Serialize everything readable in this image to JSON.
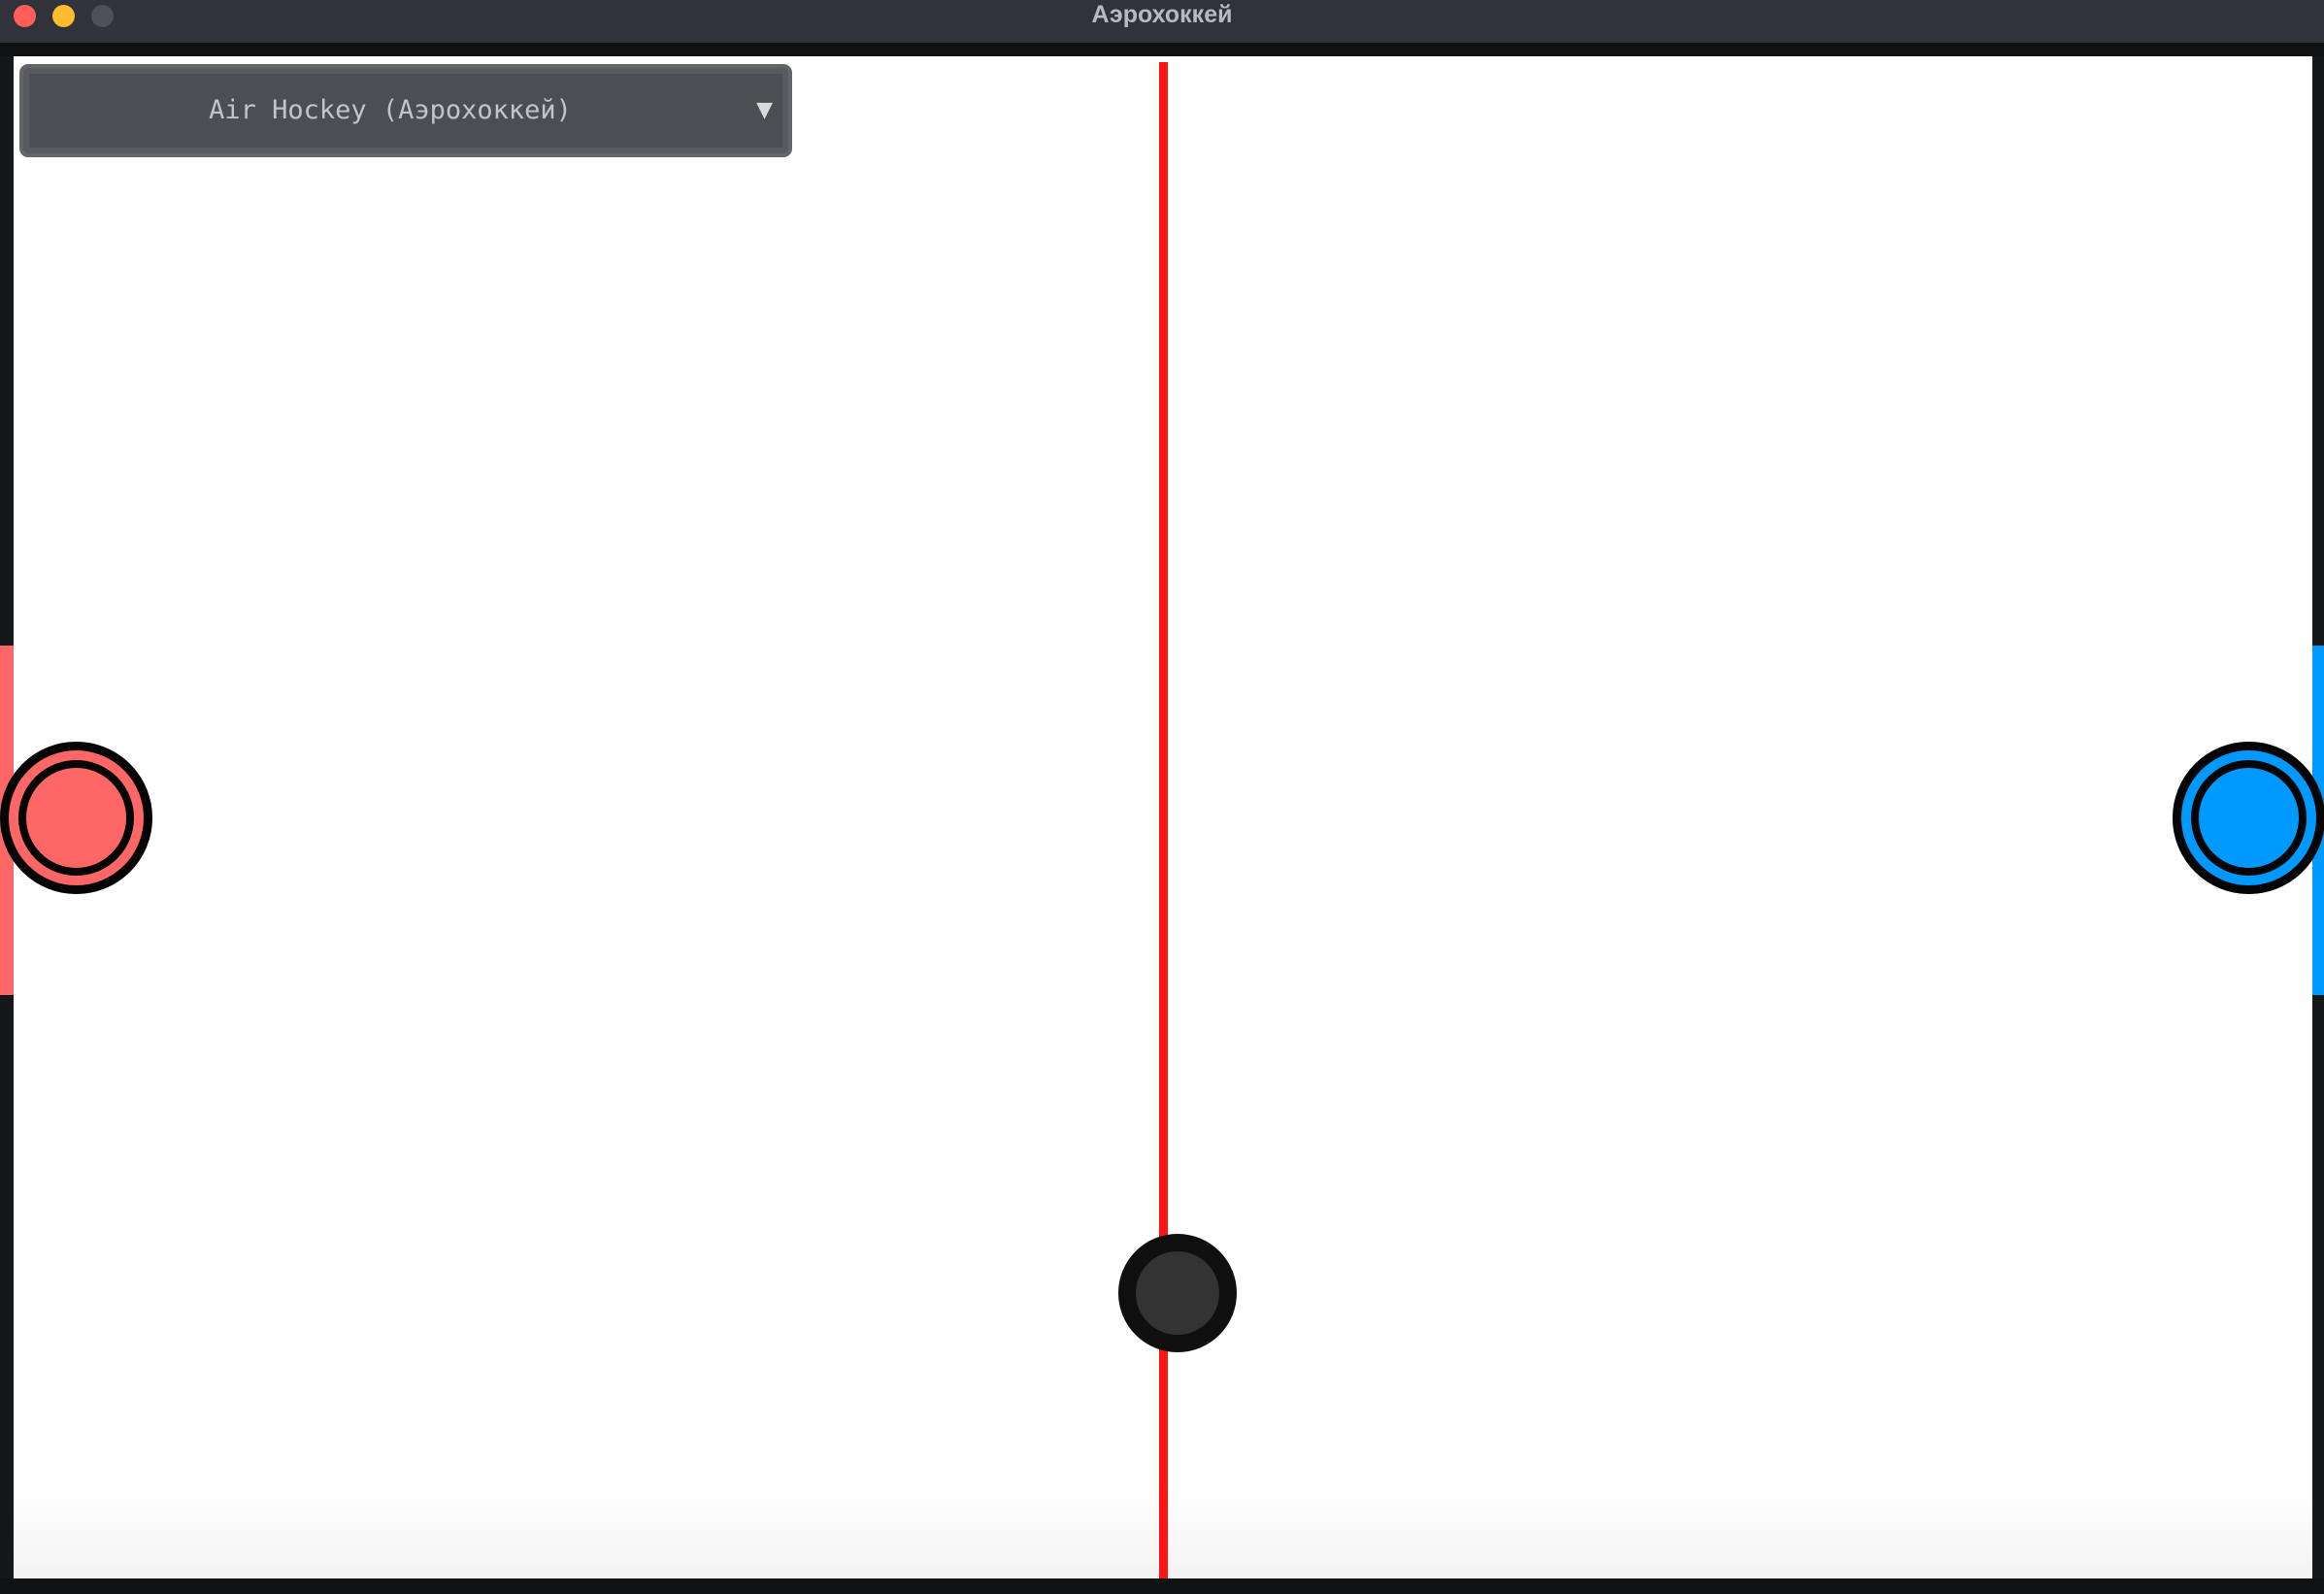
{
  "window": {
    "title": "Аэрохоккей"
  },
  "controls": {
    "game_select": {
      "value": "Air Hockey (Аэрохоккей)",
      "arrow_icon": "triangle-down-icon"
    }
  },
  "colors": {
    "titlebar_close": "#ff5f57",
    "titlebar_minimize": "#febc2e",
    "titlebar_zoom": "#505058",
    "center_line": "#ff1414",
    "red_team": "#ff6666",
    "blue_team": "#0099ff",
    "puck": "#333333",
    "rink": "#ffffff"
  },
  "game": {
    "rink": "white",
    "center_line": "red vertical line",
    "left_mallet": "red",
    "right_mallet": "blue",
    "puck": "black"
  }
}
